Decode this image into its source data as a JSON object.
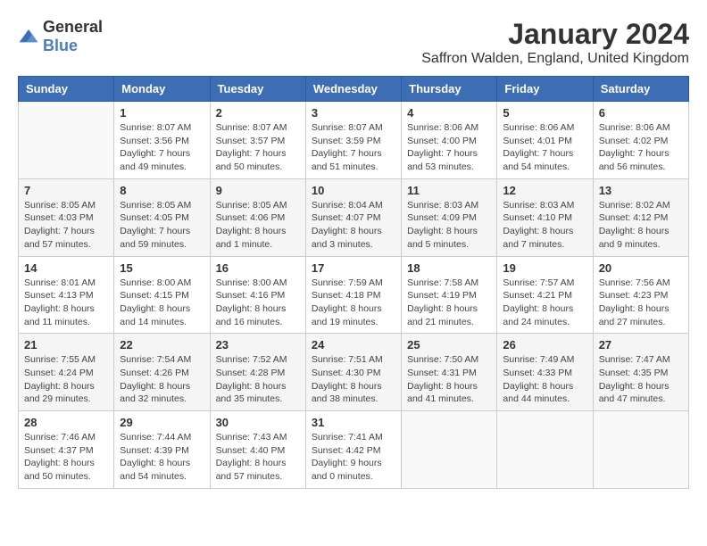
{
  "header": {
    "logo_general": "General",
    "logo_blue": "Blue",
    "month_year": "January 2024",
    "location": "Saffron Walden, England, United Kingdom"
  },
  "calendar": {
    "weekdays": [
      "Sunday",
      "Monday",
      "Tuesday",
      "Wednesday",
      "Thursday",
      "Friday",
      "Saturday"
    ],
    "weeks": [
      [
        {
          "day": "",
          "info": ""
        },
        {
          "day": "1",
          "info": "Sunrise: 8:07 AM\nSunset: 3:56 PM\nDaylight: 7 hours\nand 49 minutes."
        },
        {
          "day": "2",
          "info": "Sunrise: 8:07 AM\nSunset: 3:57 PM\nDaylight: 7 hours\nand 50 minutes."
        },
        {
          "day": "3",
          "info": "Sunrise: 8:07 AM\nSunset: 3:59 PM\nDaylight: 7 hours\nand 51 minutes."
        },
        {
          "day": "4",
          "info": "Sunrise: 8:06 AM\nSunset: 4:00 PM\nDaylight: 7 hours\nand 53 minutes."
        },
        {
          "day": "5",
          "info": "Sunrise: 8:06 AM\nSunset: 4:01 PM\nDaylight: 7 hours\nand 54 minutes."
        },
        {
          "day": "6",
          "info": "Sunrise: 8:06 AM\nSunset: 4:02 PM\nDaylight: 7 hours\nand 56 minutes."
        }
      ],
      [
        {
          "day": "7",
          "info": "Sunrise: 8:05 AM\nSunset: 4:03 PM\nDaylight: 7 hours\nand 57 minutes."
        },
        {
          "day": "8",
          "info": "Sunrise: 8:05 AM\nSunset: 4:05 PM\nDaylight: 7 hours\nand 59 minutes."
        },
        {
          "day": "9",
          "info": "Sunrise: 8:05 AM\nSunset: 4:06 PM\nDaylight: 8 hours\nand 1 minute."
        },
        {
          "day": "10",
          "info": "Sunrise: 8:04 AM\nSunset: 4:07 PM\nDaylight: 8 hours\nand 3 minutes."
        },
        {
          "day": "11",
          "info": "Sunrise: 8:03 AM\nSunset: 4:09 PM\nDaylight: 8 hours\nand 5 minutes."
        },
        {
          "day": "12",
          "info": "Sunrise: 8:03 AM\nSunset: 4:10 PM\nDaylight: 8 hours\nand 7 minutes."
        },
        {
          "day": "13",
          "info": "Sunrise: 8:02 AM\nSunset: 4:12 PM\nDaylight: 8 hours\nand 9 minutes."
        }
      ],
      [
        {
          "day": "14",
          "info": "Sunrise: 8:01 AM\nSunset: 4:13 PM\nDaylight: 8 hours\nand 11 minutes."
        },
        {
          "day": "15",
          "info": "Sunrise: 8:00 AM\nSunset: 4:15 PM\nDaylight: 8 hours\nand 14 minutes."
        },
        {
          "day": "16",
          "info": "Sunrise: 8:00 AM\nSunset: 4:16 PM\nDaylight: 8 hours\nand 16 minutes."
        },
        {
          "day": "17",
          "info": "Sunrise: 7:59 AM\nSunset: 4:18 PM\nDaylight: 8 hours\nand 19 minutes."
        },
        {
          "day": "18",
          "info": "Sunrise: 7:58 AM\nSunset: 4:19 PM\nDaylight: 8 hours\nand 21 minutes."
        },
        {
          "day": "19",
          "info": "Sunrise: 7:57 AM\nSunset: 4:21 PM\nDaylight: 8 hours\nand 24 minutes."
        },
        {
          "day": "20",
          "info": "Sunrise: 7:56 AM\nSunset: 4:23 PM\nDaylight: 8 hours\nand 27 minutes."
        }
      ],
      [
        {
          "day": "21",
          "info": "Sunrise: 7:55 AM\nSunset: 4:24 PM\nDaylight: 8 hours\nand 29 minutes."
        },
        {
          "day": "22",
          "info": "Sunrise: 7:54 AM\nSunset: 4:26 PM\nDaylight: 8 hours\nand 32 minutes."
        },
        {
          "day": "23",
          "info": "Sunrise: 7:52 AM\nSunset: 4:28 PM\nDaylight: 8 hours\nand 35 minutes."
        },
        {
          "day": "24",
          "info": "Sunrise: 7:51 AM\nSunset: 4:30 PM\nDaylight: 8 hours\nand 38 minutes."
        },
        {
          "day": "25",
          "info": "Sunrise: 7:50 AM\nSunset: 4:31 PM\nDaylight: 8 hours\nand 41 minutes."
        },
        {
          "day": "26",
          "info": "Sunrise: 7:49 AM\nSunset: 4:33 PM\nDaylight: 8 hours\nand 44 minutes."
        },
        {
          "day": "27",
          "info": "Sunrise: 7:47 AM\nSunset: 4:35 PM\nDaylight: 8 hours\nand 47 minutes."
        }
      ],
      [
        {
          "day": "28",
          "info": "Sunrise: 7:46 AM\nSunset: 4:37 PM\nDaylight: 8 hours\nand 50 minutes."
        },
        {
          "day": "29",
          "info": "Sunrise: 7:44 AM\nSunset: 4:39 PM\nDaylight: 8 hours\nand 54 minutes."
        },
        {
          "day": "30",
          "info": "Sunrise: 7:43 AM\nSunset: 4:40 PM\nDaylight: 8 hours\nand 57 minutes."
        },
        {
          "day": "31",
          "info": "Sunrise: 7:41 AM\nSunset: 4:42 PM\nDaylight: 9 hours\nand 0 minutes."
        },
        {
          "day": "",
          "info": ""
        },
        {
          "day": "",
          "info": ""
        },
        {
          "day": "",
          "info": ""
        }
      ]
    ]
  }
}
